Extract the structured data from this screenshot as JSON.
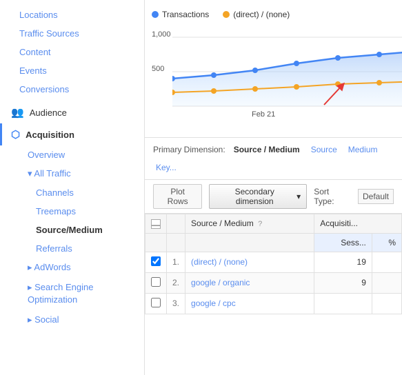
{
  "sidebar": {
    "items": [
      {
        "id": "locations",
        "label": "Locations",
        "indent": 1,
        "type": "link"
      },
      {
        "id": "traffic-sources",
        "label": "Traffic Sources",
        "indent": 1,
        "type": "link"
      },
      {
        "id": "content",
        "label": "Content",
        "indent": 1,
        "type": "link"
      },
      {
        "id": "events",
        "label": "Events",
        "indent": 1,
        "type": "link"
      },
      {
        "id": "conversions",
        "label": "Conversions",
        "indent": 1,
        "type": "link"
      }
    ],
    "audience": {
      "label": "Audience",
      "icon": "👥"
    },
    "acquisition": {
      "label": "Acquisition",
      "icon": "→",
      "active": true
    },
    "sub_items": [
      {
        "id": "overview",
        "label": "Overview",
        "indent": 2
      },
      {
        "id": "all-traffic-parent",
        "label": "▾ All Traffic",
        "indent": 2
      },
      {
        "id": "channels",
        "label": "Channels",
        "indent": 3
      },
      {
        "id": "treemaps",
        "label": "Treemaps",
        "indent": 3
      },
      {
        "id": "source-medium",
        "label": "Source/Medium",
        "indent": 3,
        "active": true
      },
      {
        "id": "referrals",
        "label": "Referrals",
        "indent": 3
      }
    ],
    "sub_items2": [
      {
        "id": "adwords",
        "label": "▸ AdWords",
        "indent": 2
      },
      {
        "id": "seo",
        "label": "▸ Search Engine\n  Optimization",
        "indent": 2
      },
      {
        "id": "social",
        "label": "▸ Social",
        "indent": 2
      }
    ]
  },
  "chart": {
    "legend": [
      {
        "id": "transactions",
        "label": "Transactions",
        "color": "#4285f4"
      },
      {
        "id": "direct-none",
        "label": "(direct) / (none)",
        "color": "#f4a425"
      }
    ],
    "y_labels": [
      "1,000",
      "500"
    ],
    "x_label": "Feb 21"
  },
  "primary_dimension": {
    "label": "Primary Dimension:",
    "options": [
      {
        "id": "source-medium",
        "label": "Source / Medium",
        "active": true
      },
      {
        "id": "source",
        "label": "Source"
      },
      {
        "id": "medium",
        "label": "Medium"
      },
      {
        "id": "keyword",
        "label": "Key..."
      }
    ]
  },
  "table_controls": {
    "plot_rows_label": "Plot Rows",
    "secondary_dim_label": "Secondary dimension",
    "sort_type_label": "Sort Type:",
    "sort_type_value": "Default"
  },
  "table": {
    "col_checkbox": "",
    "col_num": "",
    "col_source": "Source / Medium",
    "col_help": "?",
    "col_acquisition": "Acquisiti...",
    "col_sessions": "Sess...",
    "col_percent": "%",
    "rows": [
      {
        "num": "1.",
        "source": "(direct) / (none)",
        "sessions": "19",
        "checked": true
      },
      {
        "num": "2.",
        "source": "google / organic",
        "sessions": "9",
        "checked": false
      },
      {
        "num": "3.",
        "source": "google / cpc",
        "sessions": "",
        "checked": false
      }
    ]
  }
}
